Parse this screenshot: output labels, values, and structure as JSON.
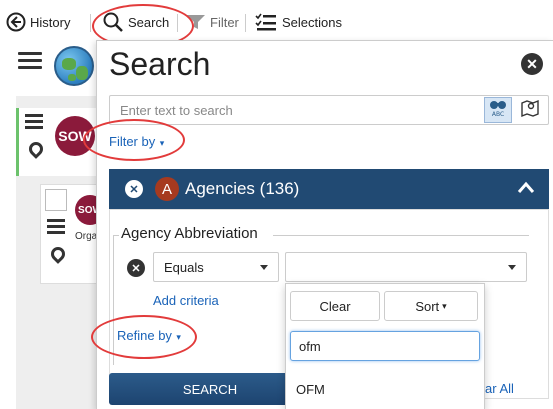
{
  "toolbar": {
    "history_label": "History",
    "search_label": "Search",
    "filter_label": "Filter",
    "selections_label": "Selections"
  },
  "background": {
    "card1_badge": "SOW",
    "card2_badge": "SOW",
    "card2_text": "Orga"
  },
  "panel": {
    "title": "Search",
    "search_placeholder": "Enter text to search",
    "filter_by_label": "Filter by",
    "agency_header": {
      "badge": "A",
      "title": "Agencies (136)"
    },
    "criteria": {
      "field_label": "Agency Abbreviation",
      "operator": "Equals",
      "value": "",
      "add_criteria_label": "Add criteria"
    },
    "refine_by_label": "Refine by",
    "search_button_label": "SEARCH",
    "clear_all_label": "ar All"
  },
  "dropdown": {
    "clear_label": "Clear",
    "sort_label": "Sort",
    "filter_value": "ofm",
    "options": [
      "OFM"
    ]
  },
  "colors": {
    "accent_blue": "#214a73",
    "link_blue": "#1a63b8",
    "badge_maroon": "#8b1a3b",
    "agency_badge": "#a63a1f",
    "annotation_red": "#e23b3b"
  }
}
